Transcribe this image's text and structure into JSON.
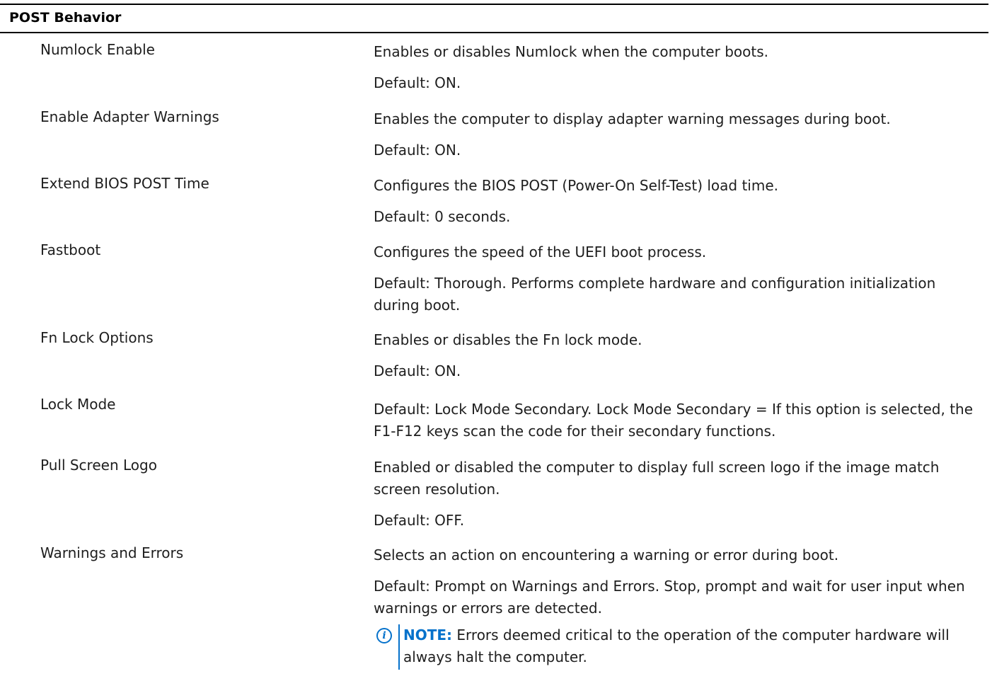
{
  "section": {
    "title": "POST Behavior"
  },
  "rows": [
    {
      "label": "Numlock Enable",
      "lines": [
        "Enables or disables Numlock when the computer boots.",
        "Default: ON."
      ]
    },
    {
      "label": "Enable Adapter Warnings",
      "lines": [
        "Enables the computer to display adapter warning messages during boot.",
        "Default: ON."
      ]
    },
    {
      "label": "Extend BIOS POST Time",
      "lines": [
        "Configures the BIOS POST (Power-On Self-Test) load time.",
        "Default: 0 seconds."
      ]
    },
    {
      "label": "Fastboot",
      "lines": [
        "Configures the speed of the UEFI boot process.",
        "Default: Thorough. Performs complete hardware and configuration initialization during boot."
      ]
    },
    {
      "label": "Fn Lock Options",
      "lines": [
        "Enables or disables the Fn lock mode.",
        "Default: ON."
      ]
    },
    {
      "label": "Lock Mode",
      "lines": [
        "Default: Lock Mode Secondary. Lock Mode Secondary = If this option is selected, the F1-F12 keys scan the code for their secondary functions."
      ]
    },
    {
      "label": "Pull Screen Logo",
      "lines": [
        "Enabled or disabled the computer to display full screen logo if the image match screen resolution.",
        "Default: OFF."
      ]
    },
    {
      "label": "Warnings and Errors",
      "lines": [
        "Selects an action on encountering a warning or error during boot.",
        "Default: Prompt on Warnings and Errors. Stop, prompt and wait for user input when warnings or errors are detected."
      ]
    }
  ],
  "note": {
    "icon": "info-icon",
    "heading": "NOTE:",
    "text": "Errors deemed critical to the operation of the computer hardware will always halt the computer.",
    "accent_color": "#0672cb"
  }
}
